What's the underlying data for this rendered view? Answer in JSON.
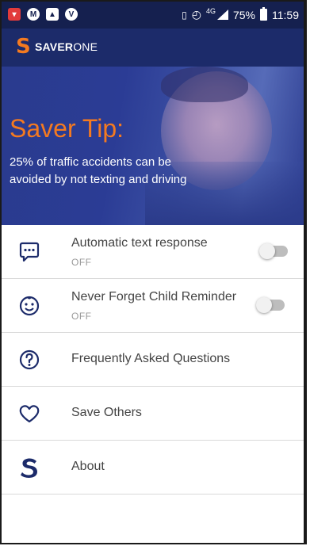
{
  "status_bar": {
    "icons_left": [
      "notification-red",
      "m-circle",
      "image",
      "v-circle"
    ],
    "network": "4G",
    "battery": "75%",
    "time": "11:59"
  },
  "app_bar": {
    "logo_letter": "S",
    "brand_bold": "SAVER",
    "brand_light": "ONE"
  },
  "hero": {
    "title": "Saver Tip:",
    "body": "25% of traffic accidents can be avoided by not texting and driving"
  },
  "menu": {
    "items": [
      {
        "label": "Automatic text response",
        "sub": "OFF",
        "icon": "message-bubble-icon"
      },
      {
        "label": "Never Forget Child Reminder",
        "sub": "OFF",
        "icon": "smiley-icon"
      },
      {
        "label": "Frequently Asked Questions",
        "icon": "question-icon"
      },
      {
        "label": "Save Others",
        "icon": "heart-icon"
      },
      {
        "label": "About",
        "icon": "saverone-s-icon"
      }
    ]
  },
  "colors": {
    "status_bar": "#15204f",
    "app_bar": "#1c2b6a",
    "accent_orange": "#f47a20",
    "icon_navy": "#1c2b6a"
  }
}
